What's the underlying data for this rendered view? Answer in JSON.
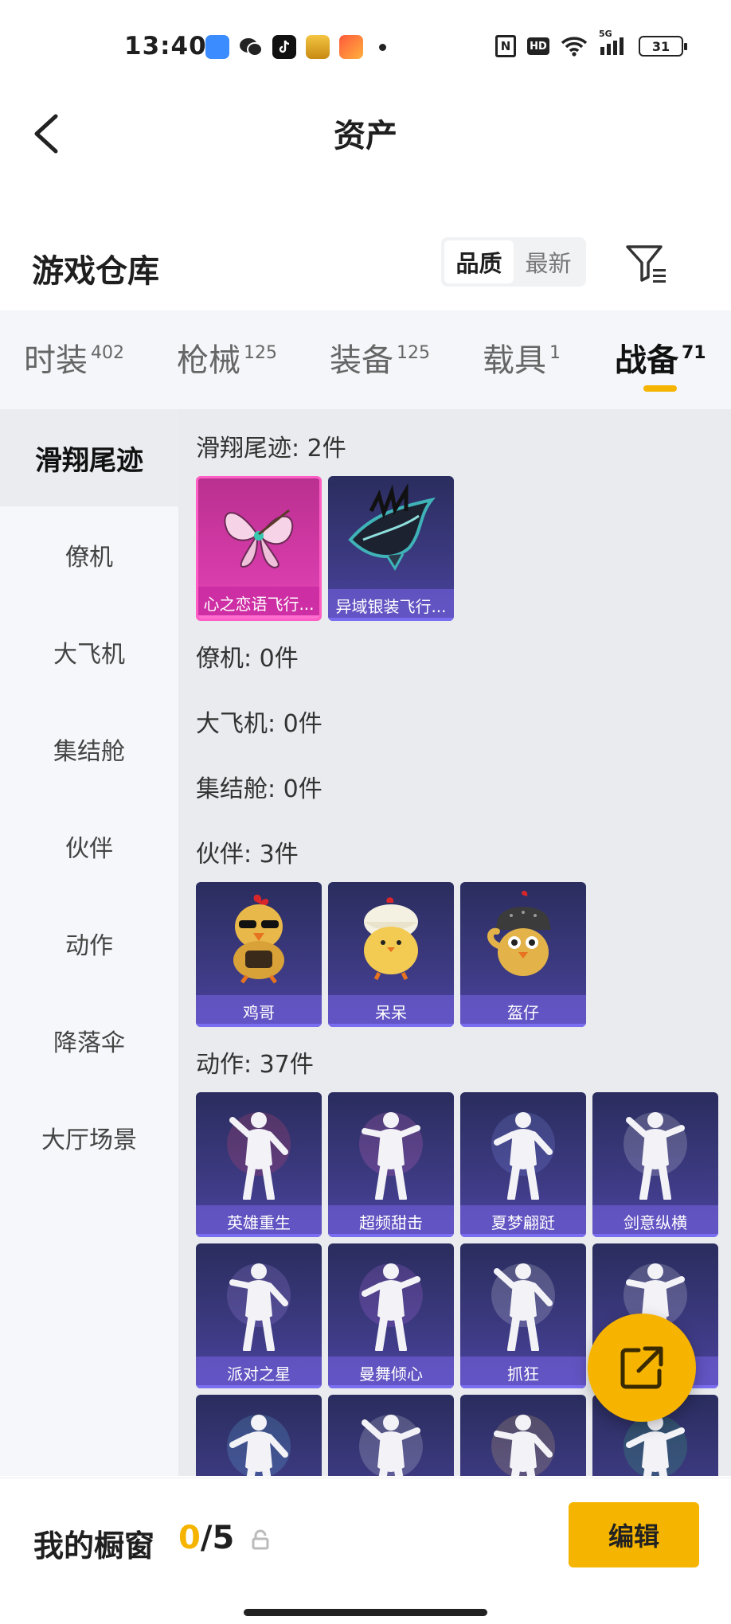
{
  "status_bar": {
    "time": "13:40",
    "battery": "31",
    "hd": "HD",
    "nfc": "N",
    "signal": "5G"
  },
  "nav": {
    "title": "资产"
  },
  "warehouse": {
    "title": "游戏仓库",
    "sort_options": [
      "品质",
      "最新"
    ],
    "sort_selected": "品质"
  },
  "category_tabs": [
    {
      "label": "时装",
      "count": "402"
    },
    {
      "label": "枪械",
      "count": "125"
    },
    {
      "label": "装备",
      "count": "125"
    },
    {
      "label": "载具",
      "count": "1"
    },
    {
      "label": "战备",
      "count": "71"
    }
  ],
  "active_category": "战备",
  "sidebar": {
    "items": [
      "滑翔尾迹",
      "僚机",
      "大飞机",
      "集结舱",
      "伙伴",
      "动作",
      "降落伞",
      "大厅场景"
    ],
    "active": "滑翔尾迹"
  },
  "sections": {
    "glide_trail": {
      "title": "滑翔尾迹: 2件",
      "items": [
        {
          "name": "心之恋语飞行...",
          "icon": "butterfly-glider-icon",
          "rarity": "pink"
        },
        {
          "name": "异域银装飞行...",
          "icon": "dragon-glider-icon",
          "rarity": "purple"
        }
      ]
    },
    "wingman": {
      "title": "僚机: 0件"
    },
    "big_plane": {
      "title": "大飞机: 0件"
    },
    "pod": {
      "title": "集结舱: 0件"
    },
    "partner": {
      "title": "伙伴: 3件",
      "items": [
        {
          "name": "鸡哥",
          "icon": "chicken-partner-icon"
        },
        {
          "name": "呆呆",
          "icon": "chick-partner-icon"
        },
        {
          "name": "盔仔",
          "icon": "helmet-chick-partner-icon"
        }
      ]
    },
    "emote": {
      "title": "动作: 37件",
      "items": [
        {
          "name": "英雄重生",
          "icon": "emote-pose-icon"
        },
        {
          "name": "超频甜击",
          "icon": "emote-pose-icon"
        },
        {
          "name": "夏梦翩跹",
          "icon": "emote-pose-icon"
        },
        {
          "name": "剑意纵横",
          "icon": "emote-pose-icon"
        },
        {
          "name": "派对之星",
          "icon": "emote-pose-icon"
        },
        {
          "name": "曼舞倾心",
          "icon": "emote-pose-icon"
        },
        {
          "name": "抓狂",
          "icon": "emote-pose-icon"
        },
        {
          "name": "",
          "icon": "emote-pose-icon"
        },
        {
          "name": "",
          "icon": "emote-pose-icon"
        },
        {
          "name": "",
          "icon": "emote-pose-icon"
        },
        {
          "name": "",
          "icon": "emote-pose-icon"
        },
        {
          "name": "",
          "icon": "emote-pose-icon"
        }
      ]
    }
  },
  "bottom": {
    "showcase_label": "我的橱窗",
    "showcase_current": "0",
    "showcase_total": "/5",
    "edit_label": "编辑"
  },
  "colors": {
    "accent": "#f5b400",
    "card_purple": "#3d3a82",
    "card_pink": "#d43aa7"
  }
}
